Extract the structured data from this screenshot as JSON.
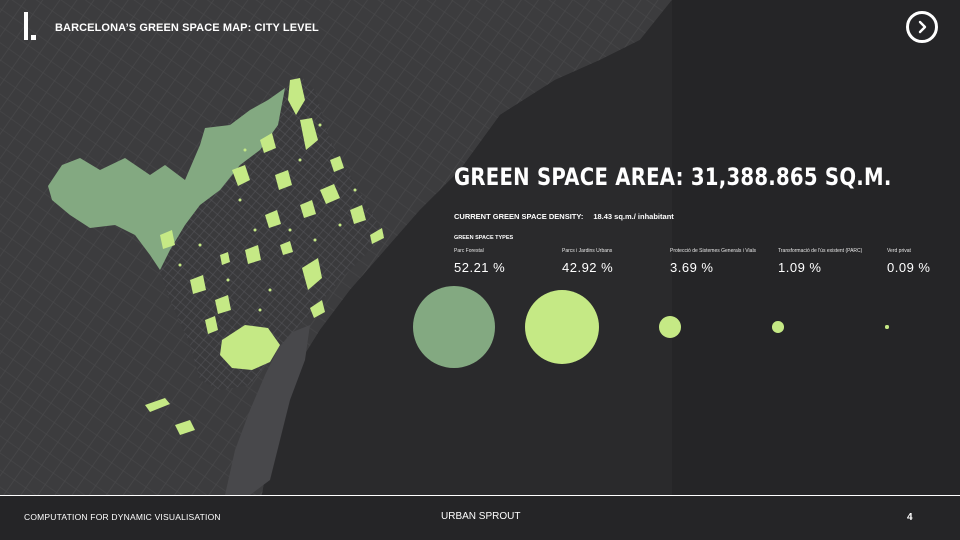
{
  "header": {
    "section_numeral": "I.",
    "title": "BARCELONA’S GREEN SPACE MAP: CITY LEVEL",
    "next_icon": "chevron-right-icon"
  },
  "stats": {
    "area_title": "GREEN SPACE AREA: 31,388.865 SQ.M.",
    "density_label": "CURRENT GREEN SPACE DENSITY:",
    "density_value": "18.43  sq.m./ inhabitant",
    "types_label": "GREEN SPACE TYPES",
    "types": [
      {
        "name": "Parc Forestal",
        "percent": "52.21  %",
        "color": "#83a981",
        "share": 52.21
      },
      {
        "name": "Parcs i Jardins Urbans",
        "percent": "42.92  %",
        "color": "#c5e985",
        "share": 42.92
      },
      {
        "name": "Protecció de Sistemes Generals i Vials",
        "percent": "3.69  %",
        "color": "#c5e985",
        "share": 3.69
      },
      {
        "name": "Transformació de l'ús existent (PARC)",
        "percent": "1.09  %",
        "color": "#c5e985",
        "share": 1.09
      },
      {
        "name": "Verd privat",
        "percent": "0.09  %",
        "color": "#c5e985",
        "share": 0.09
      }
    ]
  },
  "colors": {
    "background": "#252527",
    "map_land": "#3c3c3e",
    "map_sea": "#2a2a2c",
    "forest_green": "#83a981",
    "urban_green": "#c5e985"
  },
  "footer": {
    "left": "COMPUTATION FOR DYNAMIC VISUALISATION",
    "center": "URBAN SPROUT",
    "page_number": "4"
  }
}
